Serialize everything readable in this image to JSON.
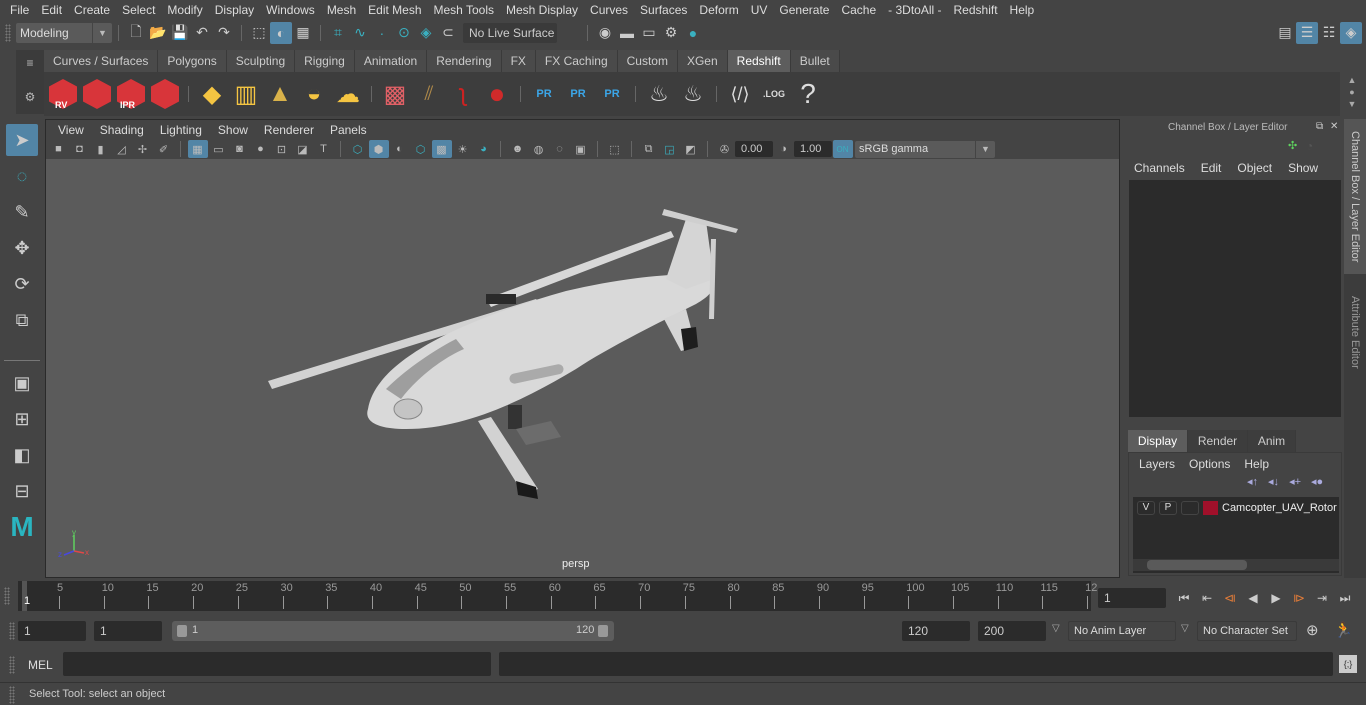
{
  "menubar": [
    "File",
    "Edit",
    "Create",
    "Select",
    "Modify",
    "Display",
    "Windows",
    "Mesh",
    "Edit Mesh",
    "Mesh Tools",
    "Mesh Display",
    "Curves",
    "Surfaces",
    "Deform",
    "UV",
    "Generate",
    "Cache",
    "- 3DtoAll -",
    "Redshift",
    "Help"
  ],
  "statusline": {
    "workspace": "Modeling",
    "live_surface": "No Live Surface"
  },
  "shelf": {
    "tabs": [
      "Curves / Surfaces",
      "Polygons",
      "Sculpting",
      "Rigging",
      "Animation",
      "Rendering",
      "FX",
      "FX Caching",
      "Custom",
      "XGen",
      "Redshift",
      "Bullet"
    ],
    "active_tab": "Redshift",
    "labels": {
      "rv": "RV",
      "ipr": "IPR",
      "pr": "PR",
      "log": ".LOG",
      "help": "?"
    }
  },
  "viewport": {
    "menu": [
      "View",
      "Shading",
      "Lighting",
      "Show",
      "Renderer",
      "Panels"
    ],
    "exposure": "0.00",
    "gamma": "1.00",
    "color_space": "sRGB gamma",
    "camera_label": "persp",
    "axis": {
      "x": "x",
      "y": "y",
      "z": "z"
    }
  },
  "channel_box": {
    "title": "Channel Box / Layer Editor",
    "menu": [
      "Channels",
      "Edit",
      "Object",
      "Show"
    ]
  },
  "layer_editor": {
    "tabs": [
      "Display",
      "Render",
      "Anim"
    ],
    "active_tab": "Display",
    "menu": [
      "Layers",
      "Options",
      "Help"
    ],
    "layers": [
      {
        "v": "V",
        "p": "P",
        "name": "Camcopter_UAV_Rotor",
        "color": "#a0102a"
      }
    ]
  },
  "side_tabs": [
    "Channel Box / Layer Editor",
    "Attribute Editor"
  ],
  "timeline": {
    "ticks": [
      "5",
      "10",
      "15",
      "20",
      "25",
      "30",
      "35",
      "40",
      "45",
      "50",
      "55",
      "60",
      "65",
      "70",
      "75",
      "80",
      "85",
      "90",
      "95",
      "100",
      "105",
      "110",
      "115",
      "12"
    ],
    "current_marker": "1",
    "current_frame": "1"
  },
  "range": {
    "start": "1",
    "playback_start": "1",
    "slider_start": "1",
    "slider_end": "120",
    "playback_end": "120",
    "end": "200",
    "anim_layer": "No Anim Layer",
    "character_set": "No Character Set"
  },
  "cmdline": {
    "label": "MEL"
  },
  "helpline": {
    "text": "Select Tool: select an object"
  },
  "colors": {
    "accent": "#5285a6",
    "redshift": "#d8353a",
    "keyframe": "#e07b39"
  }
}
